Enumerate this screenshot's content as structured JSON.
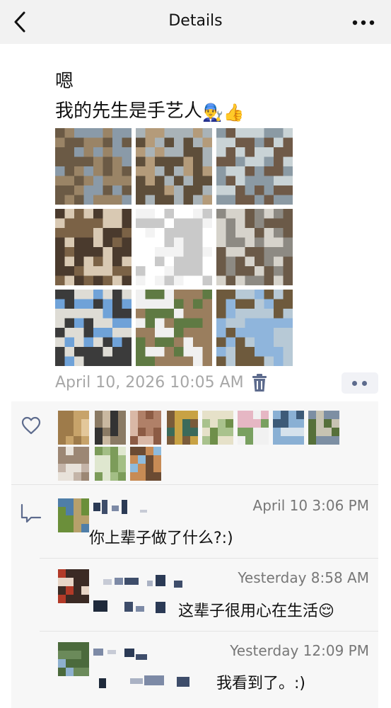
{
  "nav": {
    "title": "Details",
    "back_icon": "chevron-left-icon",
    "more_icon": "more-horizontal-icon"
  },
  "post": {
    "line1": "嗯",
    "line2": "我的先生是手艺人",
    "line2_emoji": "👨‍🔧👍",
    "timestamp": "April 10, 2026 10:05 AM",
    "delete_icon": "trash-icon",
    "options_icon": "more-dots-icon"
  },
  "photos": [
    {
      "name": "photo-bare-woods",
      "colors": [
        "#8a9aa8",
        "#6b5a45",
        "#9a8466"
      ]
    },
    {
      "name": "photo-woman-by-tree",
      "colors": [
        "#a9b3b8",
        "#5e4e3a",
        "#b49b7a"
      ]
    },
    {
      "name": "photo-trail-map-sign",
      "colors": [
        "#c9d3d6",
        "#8b9aa4",
        "#6f5a48"
      ]
    },
    {
      "name": "photo-chickens",
      "colors": [
        "#4a3a2d",
        "#7b6246",
        "#d9c9b3"
      ]
    },
    {
      "name": "photo-app-screenshot",
      "colors": [
        "#ffffff",
        "#f3f3f3",
        "#c9c9c9"
      ]
    },
    {
      "name": "photo-coop-door",
      "colors": [
        "#8d8a83",
        "#d6d3cb",
        "#6b5a48"
      ]
    },
    {
      "name": "photo-barn-roof",
      "colors": [
        "#6fa2d8",
        "#3b3b3b",
        "#dedcd5"
      ]
    },
    {
      "name": "photo-adirondack-chairs",
      "colors": [
        "#9a7e5e",
        "#5f7a43",
        "#f0f0f0"
      ]
    },
    {
      "name": "photo-bare-tree-sky",
      "colors": [
        "#8fb5dc",
        "#6e5a3d",
        "#b7c9d6"
      ]
    }
  ],
  "likes": {
    "icon": "heart-outline-icon",
    "avatars": [
      [
        "#c7a36a",
        "#9e7b4a",
        "#e3c79a"
      ],
      [
        "#333333",
        "#8a7a64",
        "#c9b8a0"
      ],
      [
        "#b08068",
        "#8c5b44",
        "#d9b8a6"
      ],
      [
        "#3b6a5a",
        "#c8a244",
        "#7a5b3a"
      ],
      [
        "#a9c28d",
        "#6f8f4a",
        "#e6e1c9"
      ],
      [
        "#e6b7c4",
        "#79a060",
        "#f1f1f1"
      ],
      [
        "#8ab0d4",
        "#3d5a78",
        "#d6e2ec"
      ],
      [
        "#7d8fa3",
        "#56703a",
        "#c7c3b2"
      ],
      [
        "#c4b4a8",
        "#9c8774",
        "#e8e2da"
      ],
      [
        "#a3be85",
        "#7c9c5a",
        "#dfe7cf"
      ],
      [
        "#8ebbdd",
        "#6b4b33",
        "#c78b55"
      ]
    ]
  },
  "comments": {
    "icon": "comment-bubble-icon",
    "items": [
      {
        "time": "April 10 3:06 PM",
        "text": "你上辈子做了什么?:)",
        "avatar": [
          "#4f7ea8",
          "#6b8f3a",
          "#b7a06b"
        ]
      },
      {
        "time": "Yesterday 8:58 AM",
        "text": "这辈子很用心在生活😌",
        "avatar": [
          "#b23a28",
          "#3b2a24",
          "#e8d5c6"
        ]
      },
      {
        "time": "Yesterday 12:09 PM",
        "text": "我看到了。:)",
        "avatar": [
          "#6b8a5a",
          "#8eb0cf",
          "#4b6a3c"
        ]
      }
    ]
  }
}
